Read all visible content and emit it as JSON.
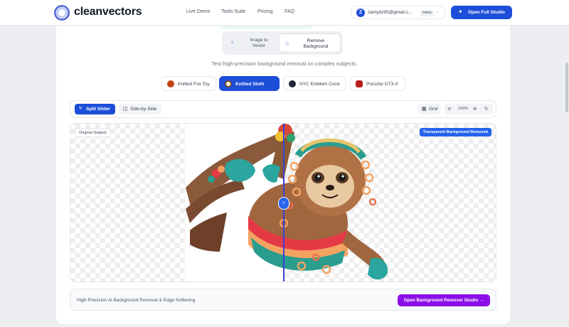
{
  "brand": {
    "name": "cleanvectors",
    "logo_icon": "globe-logo-icon"
  },
  "nav": {
    "links": [
      "Live Demo",
      "Tools Suite",
      "Pricing",
      "FAQ"
    ],
    "account": {
      "avatar_letter": "Z",
      "email": "zamydz95@gmail.c...",
      "plan_badge": "FREE"
    },
    "studio_button": "Open Full Studio"
  },
  "mode_toggle": {
    "options": [
      {
        "label_line1": "Image to",
        "label_line2": "Vector",
        "icon": "wand-icon",
        "active": false
      },
      {
        "label_line1": "Remove",
        "label_line2": "Background",
        "icon": "eraser-icon",
        "active": true
      }
    ]
  },
  "subtitle": "Test high-precision background removal on complex subjects.",
  "samples": [
    {
      "label": "Knitted Fox Toy",
      "active": false
    },
    {
      "label": "Knitted Sloth",
      "active": true
    },
    {
      "label": "NYC Emblem Crest",
      "active": false
    },
    {
      "label": "Porsche GT3-X",
      "active": false
    }
  ],
  "toolbar": {
    "split_slider": "Split Slider",
    "side_by_side": "Side-by-Side",
    "grid": "Grid",
    "zoom": "100%"
  },
  "canvas": {
    "original_label": "Original Subject",
    "removed_label": "Transparent Background Removed",
    "slider_position": 0.5
  },
  "footer": {
    "description": "High-Precision AI Background Removal & Edge Softening",
    "cta": "Open Background Remover Studio →"
  },
  "colors": {
    "primary": "#1d4ed8",
    "purple": "#8b10e8",
    "divider": "#3b3fd9"
  }
}
